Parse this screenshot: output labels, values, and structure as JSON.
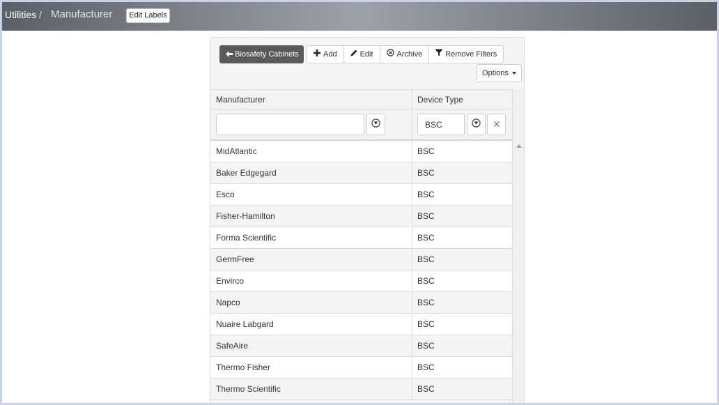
{
  "topbar": {
    "breadcrumb_root": "Utilities",
    "breadcrumb_separator": "/",
    "page_title": "Manufacturer",
    "edit_labels_button": "Edit Labels"
  },
  "toolbar": {
    "back_label": "Biosafety Cabinets",
    "add_label": "Add",
    "edit_label": "Edit",
    "archive_label": "Archive",
    "remove_filters_label": "Remove Filters",
    "options_label": "Options"
  },
  "grid": {
    "columns": [
      "Manufacturer",
      "Device Type"
    ],
    "filters": {
      "manufacturer_value": "",
      "device_type_value": "BSC"
    },
    "rows": [
      {
        "manufacturer": "MidAtlantic",
        "device_type": "BSC"
      },
      {
        "manufacturer": "Baker Edgegard",
        "device_type": "BSC"
      },
      {
        "manufacturer": "Esco",
        "device_type": "BSC"
      },
      {
        "manufacturer": "Fisher-Hamilton",
        "device_type": "BSC"
      },
      {
        "manufacturer": "Forma Scientific",
        "device_type": "BSC"
      },
      {
        "manufacturer": "GermFree",
        "device_type": "BSC"
      },
      {
        "manufacturer": "Envirco",
        "device_type": "BSC"
      },
      {
        "manufacturer": "Napco",
        "device_type": "BSC"
      },
      {
        "manufacturer": "Nuaire Labgard",
        "device_type": "BSC"
      },
      {
        "manufacturer": "SafeAire",
        "device_type": "BSC"
      },
      {
        "manufacturer": "Thermo Fisher",
        "device_type": "BSC"
      },
      {
        "manufacturer": "Thermo Scientific",
        "device_type": "BSC"
      }
    ]
  },
  "icons": {
    "back": "arrow-left-icon",
    "add": "plus-icon",
    "edit": "pencil-icon",
    "archive": "circle-x-icon",
    "remove_filters": "funnel-icon",
    "filter_menu": "filter-circle-icon",
    "clear": "close-icon",
    "scroll_up": "scroll-up-arrow-icon"
  },
  "colors": {
    "back_button_bg": "#5a5a5a",
    "topbar_mid": "#9fa1a8",
    "topbar_edge": "#5d5f66",
    "row_alt": "#f4f4f4"
  }
}
